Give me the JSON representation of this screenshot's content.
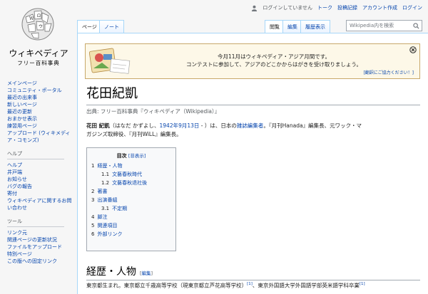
{
  "logo": {
    "name": "ウィキペディア",
    "tagline": "フリー百科事典"
  },
  "personal": {
    "not_logged_in": "ログインしていません",
    "talk": "トーク",
    "contributions": "投稿記録",
    "create_account": "アカウント作成",
    "login": "ログイン"
  },
  "tabs": {
    "page": "ページ",
    "note": "ノート",
    "read": "閲覧",
    "edit": "編集",
    "history": "履歴表示"
  },
  "search": {
    "placeholder": "Wikipedia内を検索"
  },
  "sidebar": {
    "main": [
      "メインページ",
      "コミュニティ・ポータル",
      "最近の出来事",
      "新しいページ",
      "最近の更新",
      "おまかせ表示",
      "練習用ページ",
      "アップロード (ウィキメディア・コモンズ)"
    ],
    "help_heading": "ヘルプ",
    "help": [
      "ヘルプ",
      "井戸端",
      "お知らせ",
      "バグの報告",
      "寄付",
      "ウィキペディアに関するお問い合わせ"
    ],
    "tools_heading": "ツール",
    "tools": [
      "リンク元",
      "関連ページの更新状況",
      "ファイルをアップロード",
      "特別ページ",
      "この版への固定リンク"
    ]
  },
  "banner": {
    "line1": "今月11月はウィキペディア・アジア月間です。",
    "line2": "コンテストに参加して、アジアのどこかからはがきを受け取りましょう。",
    "help": "[翻訳にご協力ください！]"
  },
  "article": {
    "title": "花田紀凱",
    "from": "出典: フリー百科事典『ウィキペディア（Wikipedia）』",
    "lead_name": "花田 紀凱",
    "lead_reading": "（はなだ かずよし、",
    "lead_date": "1942年9月13日",
    "lead_mid": " - ）は、日本の",
    "lead_link_editor": "雑誌編集者",
    "lead_rest1": "。『月刊Hanada』編集長、元ワック・マ",
    "lead_rest2": "ガジンズ取締役、『月刊WiLL』編集長。"
  },
  "toc": {
    "title": "目次",
    "toggle": "[非表示]",
    "entries": [
      {
        "num": "1",
        "label": "経歴・人物"
      },
      {
        "num": "1.1",
        "label": "文藝春秋時代"
      },
      {
        "num": "1.2",
        "label": "文藝春秋退社後"
      },
      {
        "num": "2",
        "label": "著書"
      },
      {
        "num": "3",
        "label": "出演番組"
      },
      {
        "num": "3.1",
        "label": "不定期"
      },
      {
        "num": "4",
        "label": "脚注"
      },
      {
        "num": "5",
        "label": "関連項目"
      },
      {
        "num": "6",
        "label": "外部リンク"
      }
    ]
  },
  "section": {
    "heading": "経歴・人物",
    "edit_open": "[",
    "edit": "編集",
    "edit_close": "]",
    "text1": "東京都生まれ。東京都立千歳高等学校（現東京都立芦花高等学校）",
    "ref1": "[1]",
    "text2": "、東京外国語大学外国語学部英米語学科卒業",
    "ref2": "[1]"
  }
}
